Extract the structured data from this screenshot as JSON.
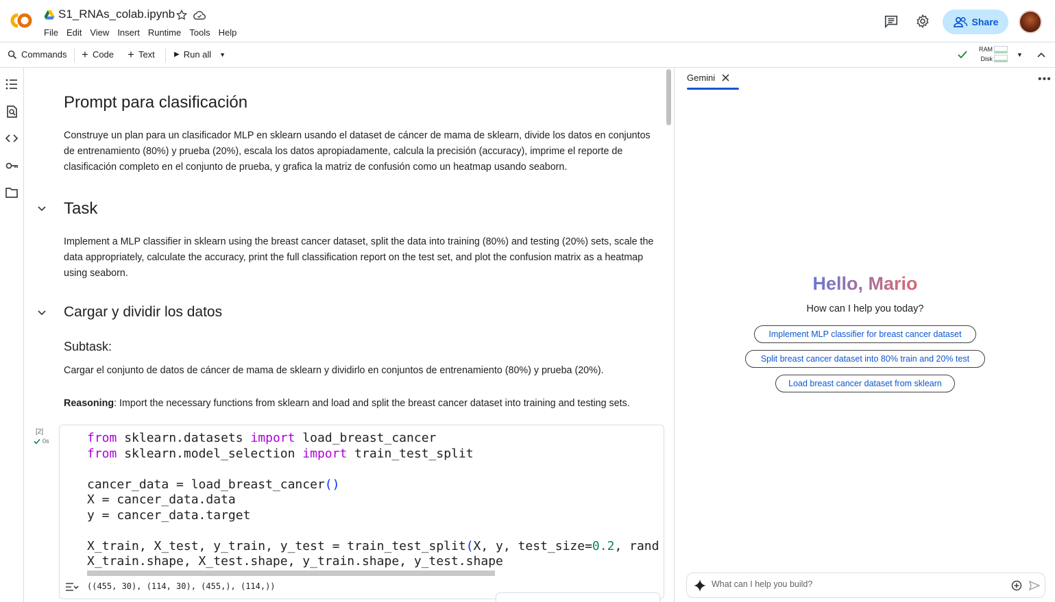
{
  "header": {
    "filename": "S1_RNAs_colab.ipynb",
    "share_label": "Share",
    "menu": [
      "File",
      "Edit",
      "View",
      "Insert",
      "Runtime",
      "Tools",
      "Help"
    ]
  },
  "toolbar": {
    "commands_label": "Commands",
    "code_label": "Code",
    "text_label": "Text",
    "run_all_label": "Run all",
    "ram_label": "RAM",
    "disk_label": "Disk"
  },
  "notebook": {
    "title1": "Prompt para clasificación",
    "para1": "Construye un plan para un clasificador MLP en sklearn usando el dataset de cáncer de mama de sklearn, divide los datos en conjuntos de entrenamiento (80%) y prueba (20%), escala los datos apropiadamente, calcula la precisión (accuracy), imprime el reporte de clasificación completo en el conjunto de prueba, y grafica la matriz de confusión como un heatmap usando seaborn.",
    "title2": "Task",
    "para2": "Implement a MLP classifier in sklearn using the breast cancer dataset, split the data into training (80%) and testing (20%) sets, scale the data appropriately, calculate the accuracy, print the full classification report on the test set, and plot the confusion matrix as a heatmap using seaborn.",
    "title3": "Cargar y dividir los datos",
    "subtask_title": "Subtask:",
    "subtask_text": "Cargar el conjunto de datos de cáncer de mama de sklearn y dividirlo en conjuntos de entrenamiento (80%) y prueba (20%).",
    "reasoning_label": "Reasoning",
    "reasoning_text": ": Import the necessary functions from sklearn and load and split the breast cancer dataset into training and testing sets.",
    "cell": {
      "exec_count": "[2]",
      "exec_time": "0s",
      "output": "((455, 30), (114, 30), (455,), (114,))",
      "code_lines": [
        "from sklearn.datasets import load_breast_cancer",
        "from sklearn.model_selection import train_test_split",
        "",
        "cancer_data = load_breast_cancer()",
        "X = cancer_data.data",
        "y = cancer_data.target",
        "",
        "X_train, X_test, y_train, y_test = train_test_split(X, y, test_size=0.2, rand",
        "X_train.shape, X_test.shape, y_train.shape, y_test.shape"
      ]
    }
  },
  "gemini": {
    "tab_label": "Gemini",
    "greeting": "Hello, Mario",
    "subtitle": "How can I help you today?",
    "suggestions": [
      "Implement MLP classifier for breast cancer dataset",
      "Split breast cancer dataset into 80% train and 20% test",
      "Load breast cancer dataset from sklearn"
    ],
    "input_placeholder": "What can I help you build?"
  },
  "colors": {
    "accent": "#0b57d0",
    "share_bg": "#c2e7ff",
    "keyword": "#af00db",
    "number": "#098658",
    "paren": "#0431fa"
  }
}
